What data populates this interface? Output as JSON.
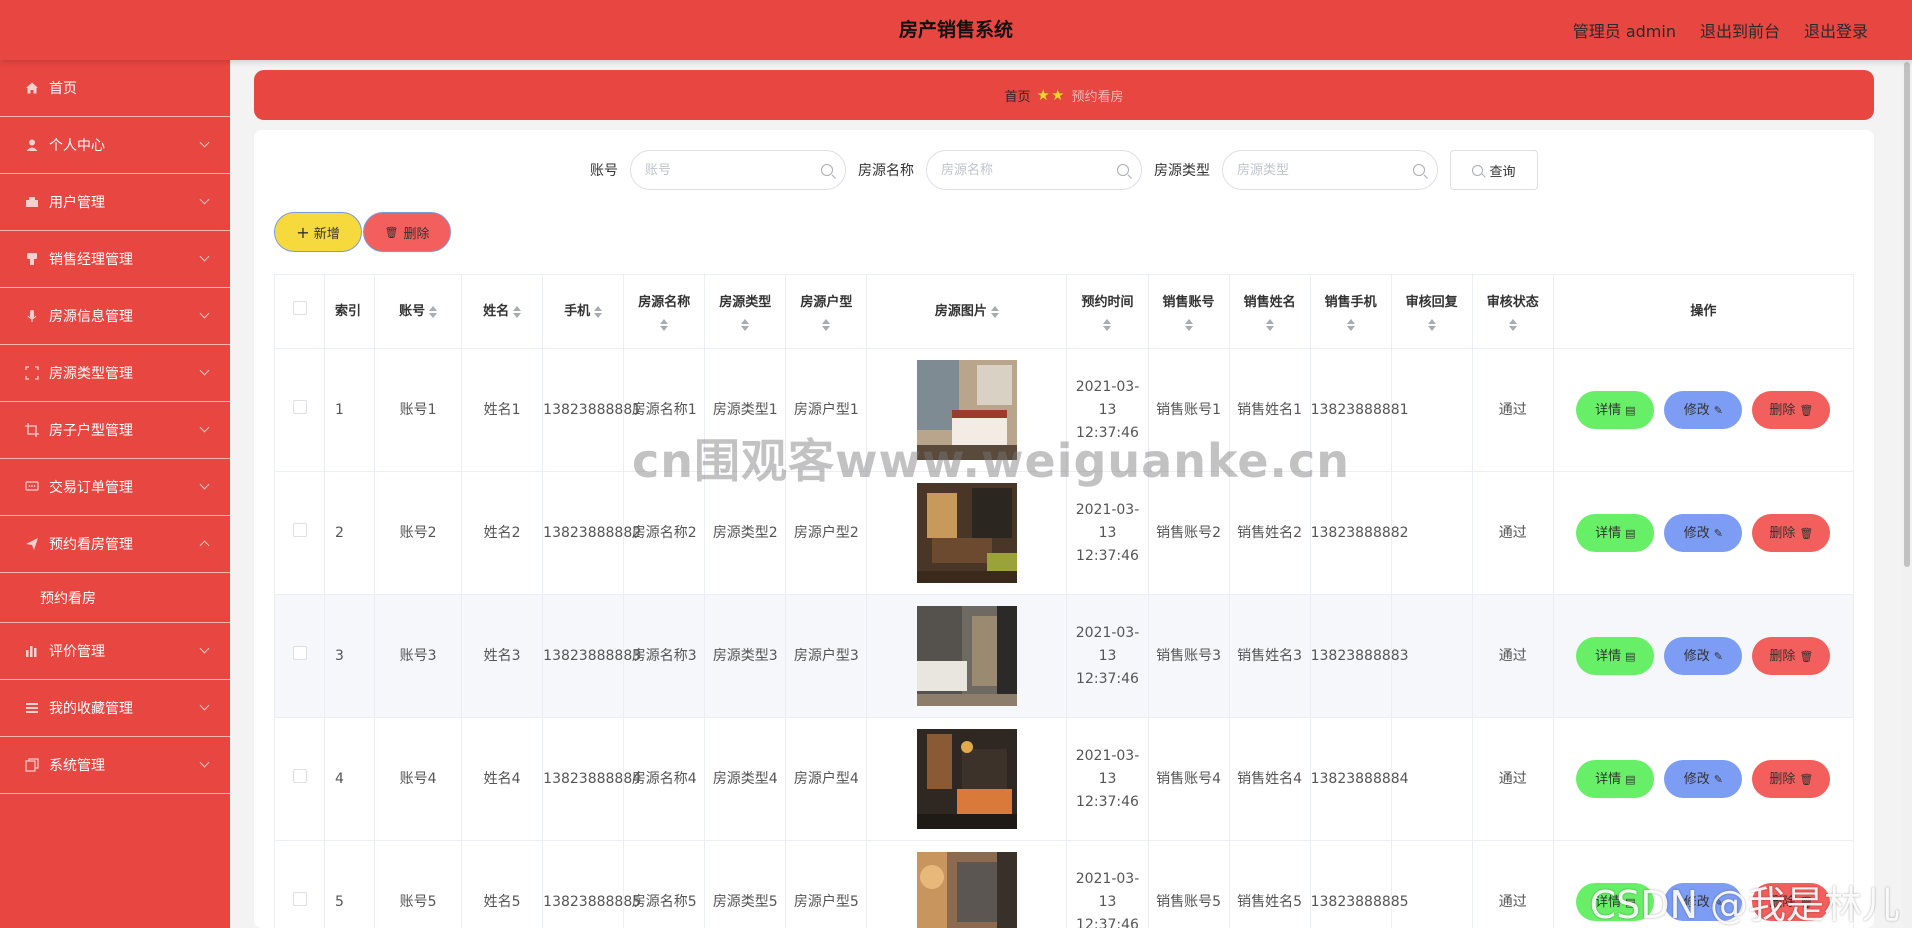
{
  "header": {
    "title": "房产销售系统",
    "admin_label": "管理员 admin",
    "front_link": "退出到前台",
    "logout_link": "退出登录"
  },
  "sidebar": {
    "items": [
      {
        "label": "首页",
        "icon": "home-icon"
      },
      {
        "label": "个人中心",
        "icon": "user-icon"
      },
      {
        "label": "用户管理",
        "icon": "users-icon"
      },
      {
        "label": "销售经理管理",
        "icon": "manager-icon"
      },
      {
        "label": "房源信息管理",
        "icon": "mic-icon"
      },
      {
        "label": "房源类型管理",
        "icon": "category-icon"
      },
      {
        "label": "房子户型管理",
        "icon": "crop-icon"
      },
      {
        "label": "交易订单管理",
        "icon": "chat-icon"
      },
      {
        "label": "预约看房管理",
        "icon": "send-icon"
      },
      {
        "label": "评价管理",
        "icon": "chart-icon"
      },
      {
        "label": "我的收藏管理",
        "icon": "menu-icon"
      },
      {
        "label": "系统管理",
        "icon": "copy-icon"
      }
    ],
    "submenu": {
      "label": "预约看房"
    }
  },
  "breadcrumb": {
    "home": "首页",
    "separator": "★★",
    "current": "预约看房"
  },
  "search": {
    "account_label": "账号",
    "account_placeholder": "账号",
    "name_label": "房源名称",
    "name_placeholder": "房源名称",
    "type_label": "房源类型",
    "type_placeholder": "房源类型",
    "query_button": "查询"
  },
  "toolbar": {
    "add_label": "新增",
    "delete_label": "删除"
  },
  "table": {
    "headers": {
      "index": "索引",
      "account": "账号",
      "name": "姓名",
      "phone": "手机",
      "house_name": "房源名称",
      "house_type": "房源类型",
      "house_layout": "房源户型",
      "house_image": "房源图片",
      "booking_time": "预约时间",
      "sales_account": "销售账号",
      "sales_name": "销售姓名",
      "sales_phone": "销售手机",
      "review_reply": "审核回复",
      "review_status": "审核状态",
      "operations": "操作"
    },
    "rows": [
      {
        "index": "1",
        "account": "账号1",
        "name": "姓名1",
        "phone": "13823888881",
        "house_name": "房源名称1",
        "house_type": "房源类型1",
        "house_layout": "房源户型1",
        "booking_time": "2021-03-13 12:37:46",
        "sales_account": "销售账号1",
        "sales_name": "销售姓名1",
        "sales_phone": "13823888881",
        "review_reply": "",
        "review_status": "通过"
      },
      {
        "index": "2",
        "account": "账号2",
        "name": "姓名2",
        "phone": "13823888882",
        "house_name": "房源名称2",
        "house_type": "房源类型2",
        "house_layout": "房源户型2",
        "booking_time": "2021-03-13 12:37:46",
        "sales_account": "销售账号2",
        "sales_name": "销售姓名2",
        "sales_phone": "13823888882",
        "review_reply": "",
        "review_status": "通过"
      },
      {
        "index": "3",
        "account": "账号3",
        "name": "姓名3",
        "phone": "13823888883",
        "house_name": "房源名称3",
        "house_type": "房源类型3",
        "house_layout": "房源户型3",
        "booking_time": "2021-03-13 12:37:46",
        "sales_account": "销售账号3",
        "sales_name": "销售姓名3",
        "sales_phone": "13823888883",
        "review_reply": "",
        "review_status": "通过"
      },
      {
        "index": "4",
        "account": "账号4",
        "name": "姓名4",
        "phone": "13823888884",
        "house_name": "房源名称4",
        "house_type": "房源类型4",
        "house_layout": "房源户型4",
        "booking_time": "2021-03-13 12:37:46",
        "sales_account": "销售账号4",
        "sales_name": "销售姓名4",
        "sales_phone": "13823888884",
        "review_reply": "",
        "review_status": "通过"
      },
      {
        "index": "5",
        "account": "账号5",
        "name": "姓名5",
        "phone": "13823888885",
        "house_name": "房源名称5",
        "house_type": "房源类型5",
        "house_layout": "房源户型5",
        "booking_time": "2021-03-13 12:37:46",
        "sales_account": "销售账号5",
        "sales_name": "销售姓名5",
        "sales_phone": "13823888885",
        "review_reply": "",
        "review_status": "通过"
      }
    ],
    "row_actions": {
      "detail": "详情",
      "edit": "修改",
      "delete": "删除"
    }
  },
  "watermarks": {
    "main": "cn围观客www.weiguanke.cn",
    "corner": "CSDN @我是林儿"
  },
  "colors": {
    "brand_red": "#e84641",
    "add_yellow": "#f5d93d",
    "detail_green": "#67f067",
    "edit_blue": "#7d9cf4",
    "delete_red": "#f25f5c"
  }
}
